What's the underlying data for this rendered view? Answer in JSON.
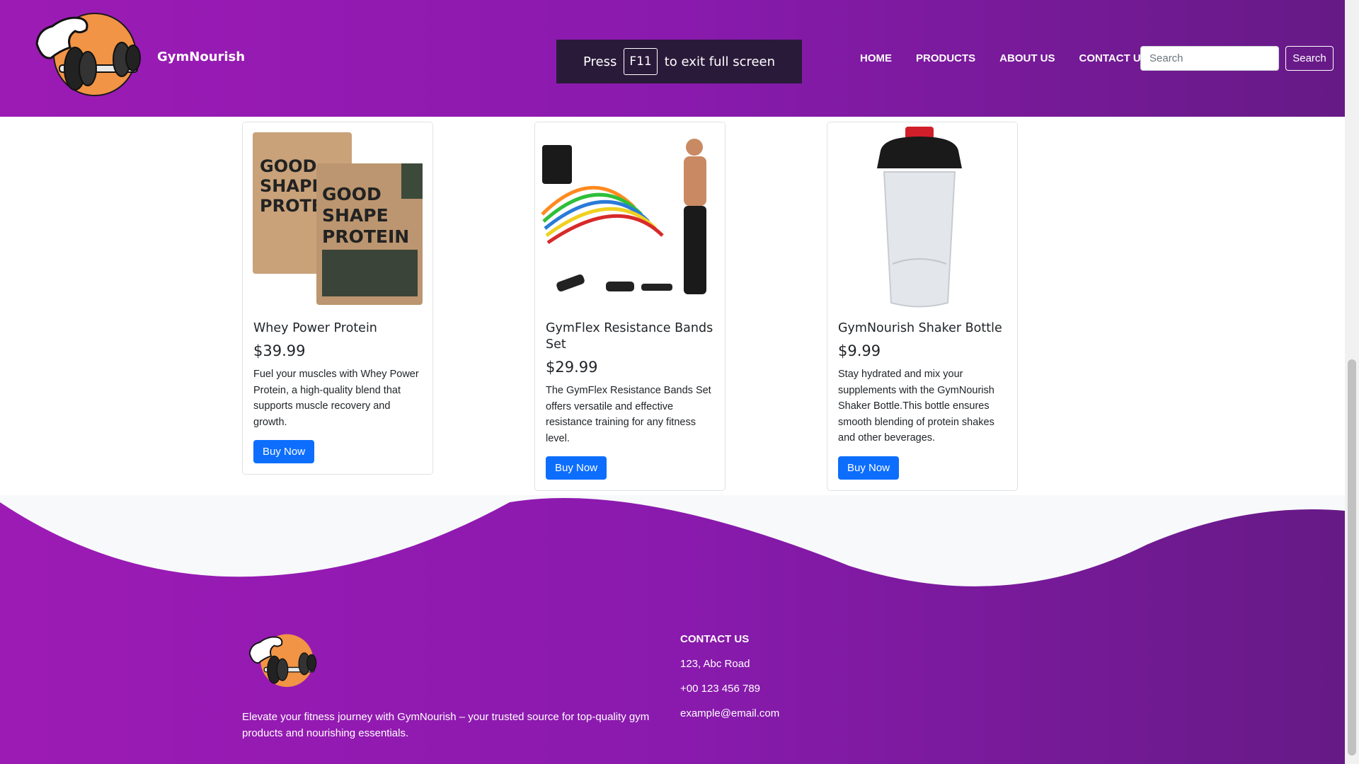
{
  "brand": {
    "name": "GymNourish"
  },
  "nav": {
    "items": [
      "HOME",
      "PRODUCTS",
      "ABOUT US",
      "CONTACT US"
    ]
  },
  "search": {
    "placeholder": "Search",
    "button_label": "Search"
  },
  "fullscreen_notice": {
    "before": "Press",
    "key": "F11",
    "after": "to exit full screen"
  },
  "products": [
    {
      "title": "Whey Power Protein",
      "price": "$39.99",
      "description": "Fuel your muscles with Whey Power Protein, a high-quality blend that supports muscle recovery and growth.",
      "button": "Buy Now",
      "image": "protein-bags"
    },
    {
      "title": "GymFlex Resistance Bands Set",
      "price": "$29.99",
      "description": "The GymFlex Resistance Bands Set offers versatile and effective resistance training for any fitness level.",
      "button": "Buy Now",
      "image": "resistance-bands"
    },
    {
      "title": "GymNourish Shaker Bottle",
      "price": "$9.99",
      "description": "Stay hydrated and mix your supplements with the GymNourish Shaker Bottle.This bottle ensures smooth blending of protein shakes and other beverages.",
      "button": "Buy Now",
      "image": "shaker-bottle"
    }
  ],
  "footer": {
    "about": "Elevate your fitness journey with GymNourish – your trusted source for top-quality gym products and nourishing essentials.",
    "contact_title": "CONTACT US",
    "address": "123, Abc Road",
    "phone": "+00 123 456 789",
    "email": "example@email.com"
  },
  "colors": {
    "purple_light": "#9c1bb5",
    "purple_dark": "#661a86",
    "button_blue": "#0d6efd",
    "logo_orange": "#f29445"
  }
}
